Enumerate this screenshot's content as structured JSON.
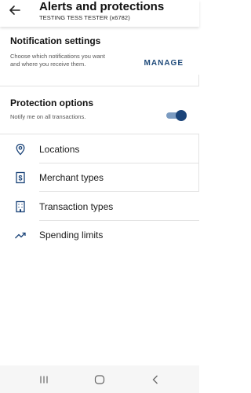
{
  "header": {
    "title": "Alerts and protections",
    "subtitle": "TESTING TESS TESTER (x6782)"
  },
  "notification_settings": {
    "title": "Notification settings",
    "description": "Choose which notifications you want and where you receive them.",
    "manage_label": "MANAGE"
  },
  "protection_options": {
    "title": "Protection options",
    "description": "Notify me on all transactions.",
    "toggle_on": true
  },
  "menu": {
    "items": [
      {
        "label": "Locations",
        "icon": "location-pin-icon"
      },
      {
        "label": "Merchant types",
        "icon": "dollar-receipt-icon"
      },
      {
        "label": "Transaction types",
        "icon": "building-icon"
      },
      {
        "label": "Spending limits",
        "icon": "trending-up-icon"
      }
    ]
  },
  "colors": {
    "accent": "#1b4479",
    "toggle_track": "#7b9bc1",
    "manage_text": "#1f4a7a"
  }
}
